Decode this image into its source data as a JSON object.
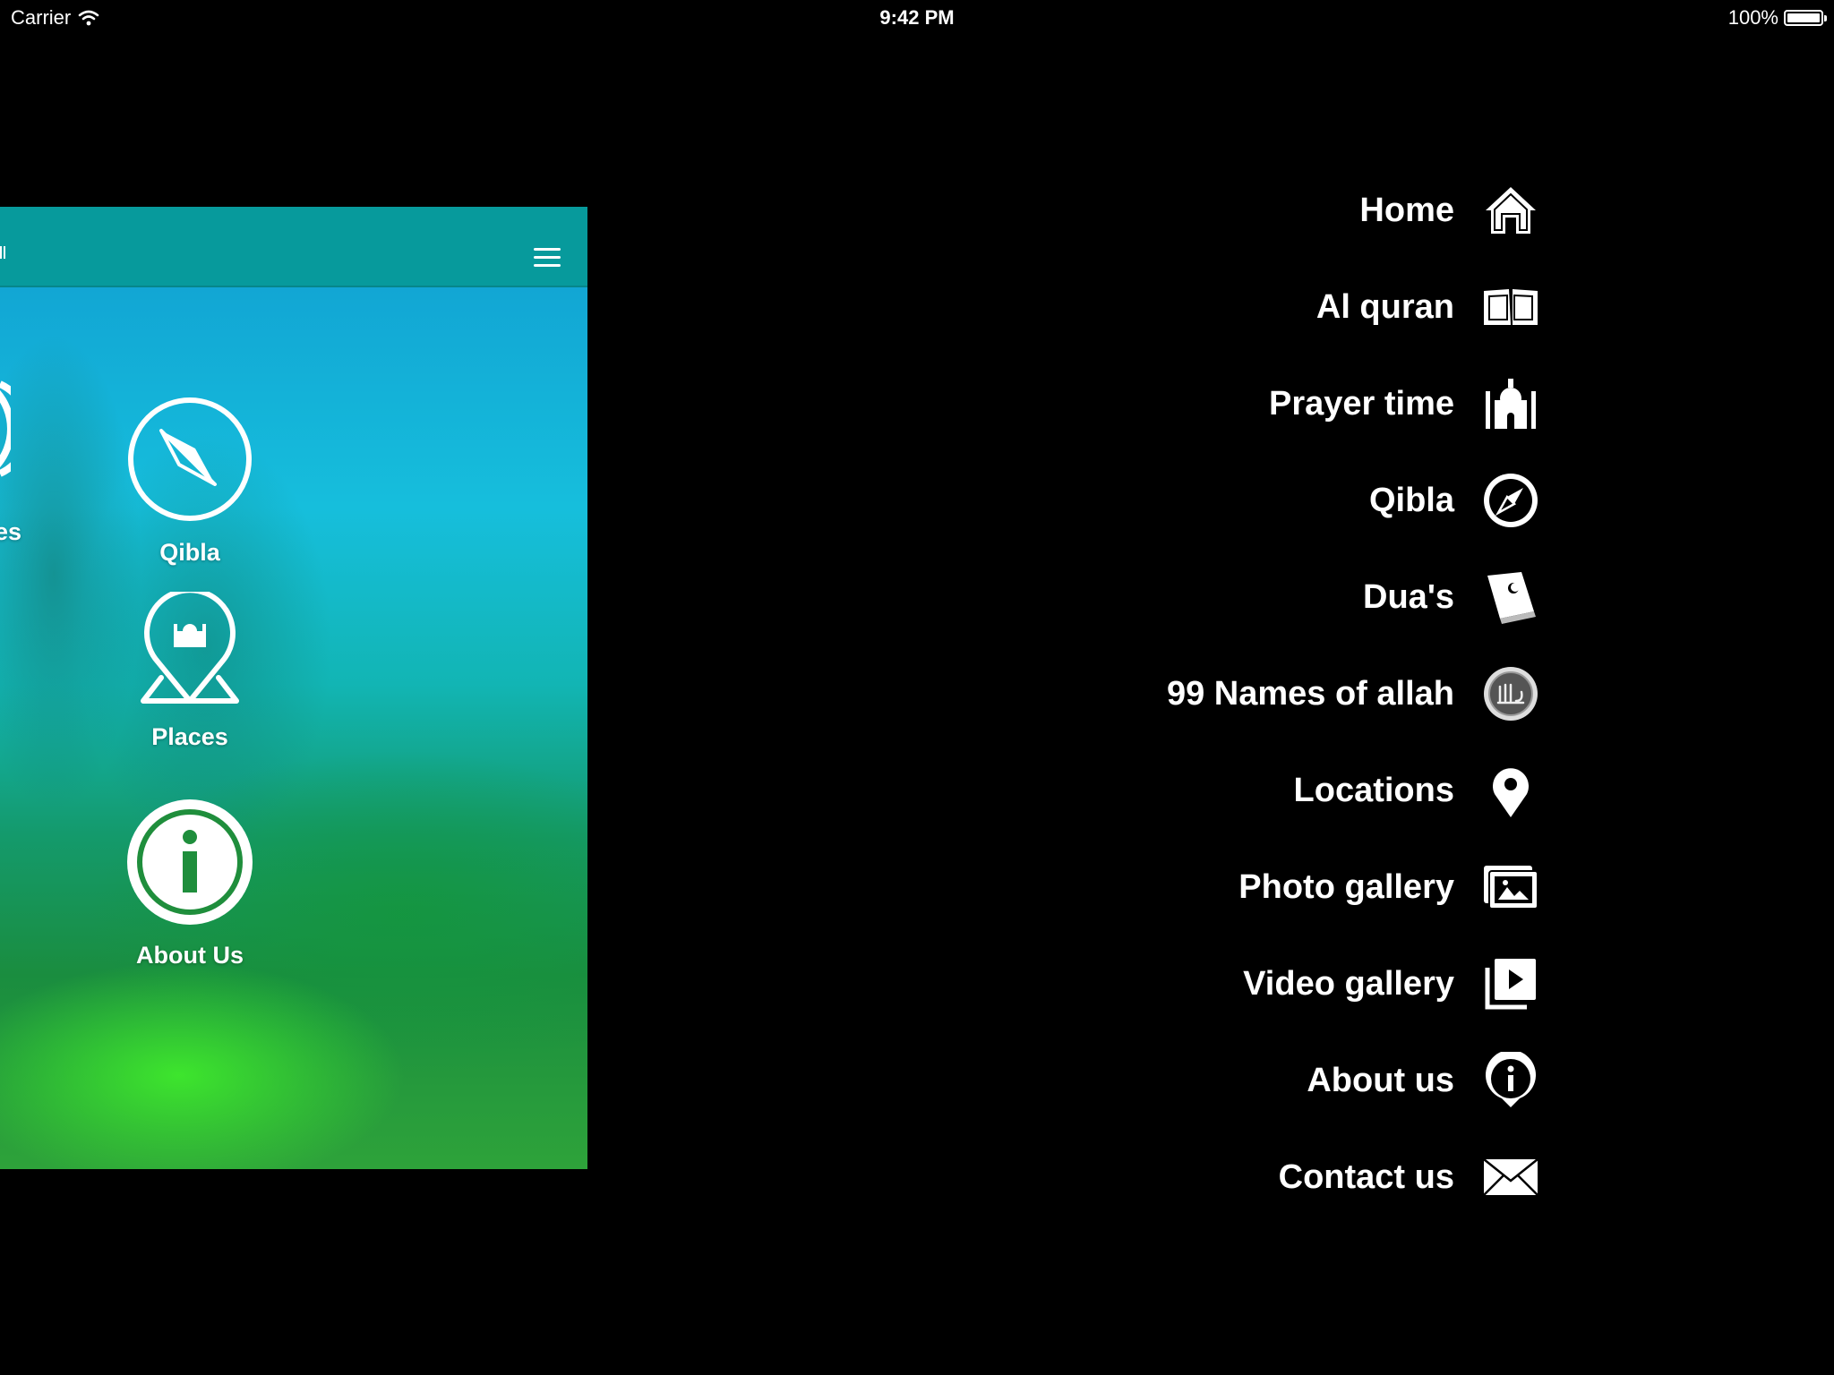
{
  "status_bar": {
    "carrier": "Carrier",
    "time": "9:42 PM",
    "battery_label": "100%",
    "battery_level": 1.0
  },
  "app_screen": {
    "tiles": [
      {
        "label": "es",
        "icon": "partial-icon"
      },
      {
        "label": "Qibla",
        "icon": "compass-icon"
      },
      {
        "label": "Places",
        "icon": "mosque-map-pin-icon"
      },
      {
        "label": "About Us",
        "icon": "info-icon"
      }
    ],
    "header_icon": "hamburger-menu-icon",
    "colors": {
      "header": "#079a9c"
    }
  },
  "side_menu": {
    "items": [
      {
        "label": "Home",
        "icon": "home-icon"
      },
      {
        "label": "Al quran",
        "icon": "open-book-icon"
      },
      {
        "label": "Prayer time",
        "icon": "mosque-icon"
      },
      {
        "label": "Qibla",
        "icon": "compass-icon"
      },
      {
        "label": "Dua's",
        "icon": "quran-book-icon"
      },
      {
        "label": "99 Names of allah",
        "icon": "allah-calligraphy-icon"
      },
      {
        "label": "Locations",
        "icon": "location-pin-icon"
      },
      {
        "label": "Photo gallery",
        "icon": "photo-gallery-icon"
      },
      {
        "label": "Video gallery",
        "icon": "video-gallery-icon"
      },
      {
        "label": "About us",
        "icon": "info-pin-icon"
      },
      {
        "label": "Contact us",
        "icon": "envelope-icon"
      }
    ]
  }
}
